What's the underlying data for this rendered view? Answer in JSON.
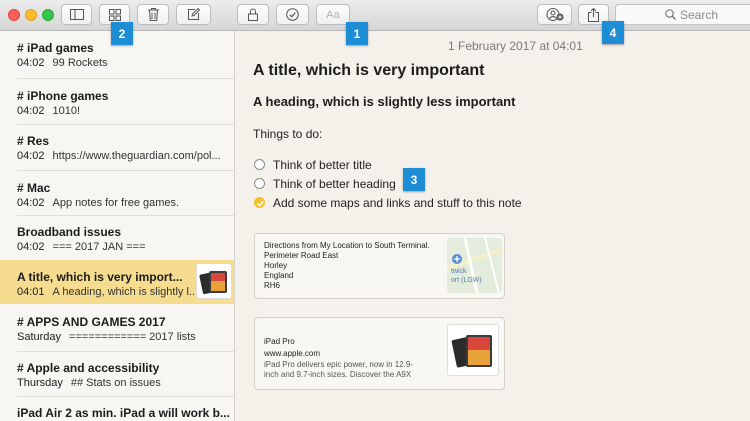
{
  "window": {
    "traffic_lights": {
      "close": "#fc5f57",
      "minimize": "#fdbc2e",
      "zoom": "#34c749"
    }
  },
  "toolbar": {
    "buttons": {
      "sidebar_toggle": {
        "icon": "sidebar-icon"
      },
      "attachments": {
        "icon": "grid-icon"
      },
      "delete": {
        "icon": "trash-icon"
      },
      "new_note": {
        "icon": "compose-icon"
      },
      "lock": {
        "icon": "lock-icon"
      },
      "checklist": {
        "icon": "checkmark-circle-icon"
      },
      "format": {
        "icon": "format-text-icon",
        "label": "Aa"
      },
      "add_people": {
        "icon": "add-people-icon"
      },
      "share": {
        "icon": "share-icon"
      }
    },
    "search": {
      "placeholder": "Search"
    }
  },
  "callouts": [
    "1",
    "2",
    "3",
    "4"
  ],
  "accent_color": "#1d8ed6",
  "sidebar": {
    "notes": [
      {
        "title": "# iPad games",
        "time": "04:02",
        "preview": "99 Rockets"
      },
      {
        "title": "# iPhone games",
        "time": "04:02",
        "preview": "1010!"
      },
      {
        "title": "# Res",
        "time": "04:02",
        "preview": "https://www.theguardian.com/pol..."
      },
      {
        "title": "# Mac",
        "time": "04:02",
        "preview": "App notes for free games."
      },
      {
        "title": "Broadband issues",
        "time": "04:02",
        "preview": "=== 2017 JAN ==="
      },
      {
        "title": "A title, which is very import...",
        "time": "04:01",
        "preview": "A heading, which is slightly l...",
        "selected": true,
        "has_thumbnail": true
      },
      {
        "title": "# APPS AND GAMES 2017",
        "time": "Saturday",
        "preview": "============ 2017 lists"
      },
      {
        "title": "# Apple and accessibility",
        "time": "Thursday",
        "preview": "## Stats on issues"
      },
      {
        "title": "iPad Air 2 as min. iPad a will work b...",
        "time": "",
        "preview": ""
      }
    ],
    "selected_color": "#f6dc8e"
  },
  "editor": {
    "date": "1 February 2017 at 04:01",
    "title": "A title, which is very important",
    "heading": "A heading, which is slightly less important",
    "todo_label": "Things to do:",
    "checklist": [
      {
        "text": "Think of better title",
        "checked": false
      },
      {
        "text": "Think of better heading",
        "checked": false
      },
      {
        "text": "Add some maps and links and stuff to this note",
        "checked": true
      }
    ],
    "map_card": {
      "lines": [
        "Directions from My Location to South Terminal.",
        "Perimeter Road East",
        "Horley",
        "England",
        "RH6"
      ],
      "map_labels": [
        "twick",
        "ort (LGW)"
      ]
    },
    "link_card": {
      "title": "iPad Pro",
      "url": "www.apple.com",
      "description_lines": [
        "iPad Pro delivers epic power, now in 12.9-",
        "inch and 9.7-inch sizes. Discover the A9X"
      ]
    }
  }
}
